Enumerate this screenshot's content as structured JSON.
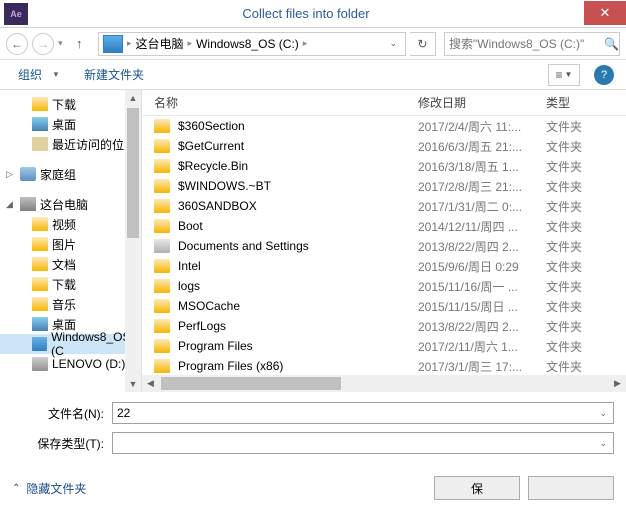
{
  "window": {
    "title": "Collect files into folder",
    "app_icon_label": "Ae"
  },
  "nav": {
    "breadcrumb": [
      "这台电脑",
      "Windows8_OS (C:)"
    ],
    "search_placeholder": "搜索\"Windows8_OS (C:)\""
  },
  "toolbar": {
    "organize": "组织",
    "new_folder": "新建文件夹"
  },
  "sidebar": {
    "items": [
      {
        "label": "下载",
        "icon": "folder",
        "lvl": 2
      },
      {
        "label": "桌面",
        "icon": "desktop",
        "lvl": 2
      },
      {
        "label": "最近访问的位置",
        "icon": "recent",
        "lvl": 2
      },
      {
        "gap": true
      },
      {
        "label": "家庭组",
        "icon": "homegroup",
        "lvl": 1,
        "exp": "▷"
      },
      {
        "gap": true
      },
      {
        "label": "这台电脑",
        "icon": "pc",
        "lvl": 1,
        "exp": "◢"
      },
      {
        "label": "视频",
        "icon": "folder",
        "lvl": 2
      },
      {
        "label": "图片",
        "icon": "folder",
        "lvl": 2
      },
      {
        "label": "文档",
        "icon": "folder",
        "lvl": 2
      },
      {
        "label": "下载",
        "icon": "folder",
        "lvl": 2
      },
      {
        "label": "音乐",
        "icon": "folder",
        "lvl": 2
      },
      {
        "label": "桌面",
        "icon": "desktop",
        "lvl": 2
      },
      {
        "label": "Windows8_OS (C",
        "icon": "drive",
        "lvl": 2,
        "selected": true
      },
      {
        "label": "LENOVO (D:)",
        "icon": "drive",
        "lvl": 2
      }
    ]
  },
  "columns": {
    "name": "名称",
    "date": "修改日期",
    "type": "类型"
  },
  "files": [
    {
      "name": "$360Section",
      "date": "2017/2/4/周六 11:...",
      "type": "文件夹",
      "icon": "folder"
    },
    {
      "name": "$GetCurrent",
      "date": "2016/6/3/周五 21:...",
      "type": "文件夹",
      "icon": "folder"
    },
    {
      "name": "$Recycle.Bin",
      "date": "2016/3/18/周五 1...",
      "type": "文件夹",
      "icon": "folder"
    },
    {
      "name": "$WINDOWS.~BT",
      "date": "2017/2/8/周三 21:...",
      "type": "文件夹",
      "icon": "folder"
    },
    {
      "name": "360SANDBOX",
      "date": "2017/1/31/周二 0:...",
      "type": "文件夹",
      "icon": "folder"
    },
    {
      "name": "Boot",
      "date": "2014/12/11/周四 ...",
      "type": "文件夹",
      "icon": "folder"
    },
    {
      "name": "Documents and Settings",
      "date": "2013/8/22/周四 2...",
      "type": "文件夹",
      "icon": "link"
    },
    {
      "name": "Intel",
      "date": "2015/9/6/周日 0:29",
      "type": "文件夹",
      "icon": "folder"
    },
    {
      "name": "logs",
      "date": "2015/11/16/周一 ...",
      "type": "文件夹",
      "icon": "folder"
    },
    {
      "name": "MSOCache",
      "date": "2015/11/15/周日 ...",
      "type": "文件夹",
      "icon": "folder"
    },
    {
      "name": "PerfLogs",
      "date": "2013/8/22/周四 2...",
      "type": "文件夹",
      "icon": "folder"
    },
    {
      "name": "Program Files",
      "date": "2017/2/11/周六 1...",
      "type": "文件夹",
      "icon": "folder"
    },
    {
      "name": "Program Files (x86)",
      "date": "2017/3/1/周三 17:...",
      "type": "文件夹",
      "icon": "folder"
    }
  ],
  "fields": {
    "filename_label": "文件名(N):",
    "filename_value": "22",
    "filetype_label": "保存类型(T):",
    "filetype_value": ""
  },
  "footer": {
    "hide_folders": "隐藏文件夹",
    "save": "保",
    "cancel": ""
  }
}
